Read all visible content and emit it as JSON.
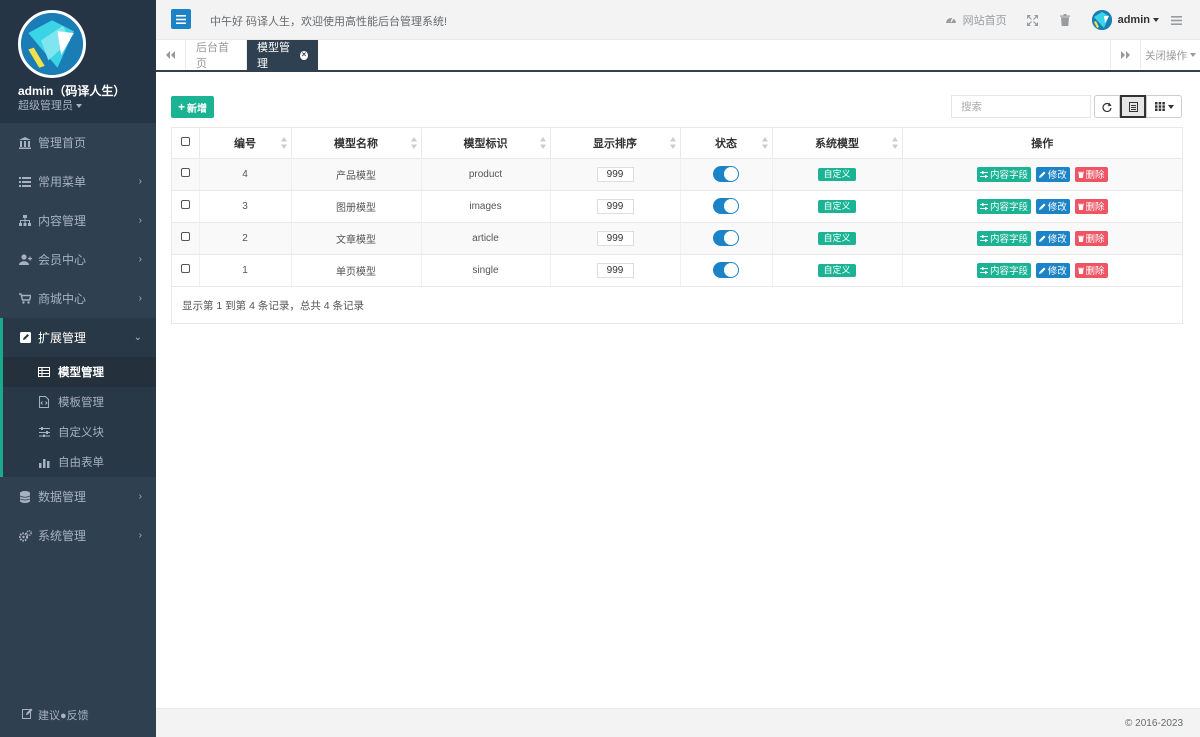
{
  "profile": {
    "name": "admin（码译人生）",
    "role": "超级管理员"
  },
  "sidebar": {
    "items": [
      {
        "label": "管理首页",
        "icon": "bank-icon"
      },
      {
        "label": "常用菜单",
        "icon": "list-icon"
      },
      {
        "label": "内容管理",
        "icon": "sitemap-icon"
      },
      {
        "label": "会员中心",
        "icon": "user-plus-icon"
      },
      {
        "label": "商城中心",
        "icon": "cart-icon"
      }
    ],
    "active_group": {
      "label": "扩展管理",
      "icon": "edit-square-icon"
    },
    "subitems": [
      {
        "label": "模型管理",
        "icon": "table-icon"
      },
      {
        "label": "模板管理",
        "icon": "file-code-icon"
      },
      {
        "label": "自定义块",
        "icon": "sliders-icon"
      },
      {
        "label": "自由表单",
        "icon": "bar-chart-icon"
      }
    ],
    "items_after": [
      {
        "label": "数据管理",
        "icon": "database-icon"
      },
      {
        "label": "系统管理",
        "icon": "cogs-icon"
      }
    ],
    "footer": "建议●反馈"
  },
  "topbar": {
    "greeting": "中午好 码译人生，欢迎使用高性能后台管理系统!",
    "site_home": "网站首页",
    "user": "admin"
  },
  "tabs": {
    "home": "后台首页",
    "active": "模型管理",
    "close_ops": "关闭操作"
  },
  "toolbar": {
    "add_label": "新增",
    "search_placeholder": "搜索"
  },
  "table": {
    "headers": [
      "编号",
      "模型名称",
      "模型标识",
      "显示排序",
      "状态",
      "系统模型",
      "操作"
    ],
    "rows": [
      {
        "id": "4",
        "name": "产品模型",
        "key": "product",
        "order": "999",
        "badge": "自定义"
      },
      {
        "id": "3",
        "name": "图册模型",
        "key": "images",
        "order": "999",
        "badge": "自定义"
      },
      {
        "id": "2",
        "name": "文章模型",
        "key": "article",
        "order": "999",
        "badge": "自定义"
      },
      {
        "id": "1",
        "name": "单页模型",
        "key": "single",
        "order": "999",
        "badge": "自定义"
      }
    ],
    "actions": {
      "fields": "内容字段",
      "edit": "修改",
      "delete": "删除"
    },
    "pager_info": "显示第 1 到第 4 条记录，总共 4 条记录"
  },
  "footer": {
    "copyright": "© 2016-2023"
  },
  "colors": {
    "sidebar": "#2f4050",
    "primary": "#1ab394",
    "blue": "#1c84c6",
    "danger": "#ed5565"
  }
}
